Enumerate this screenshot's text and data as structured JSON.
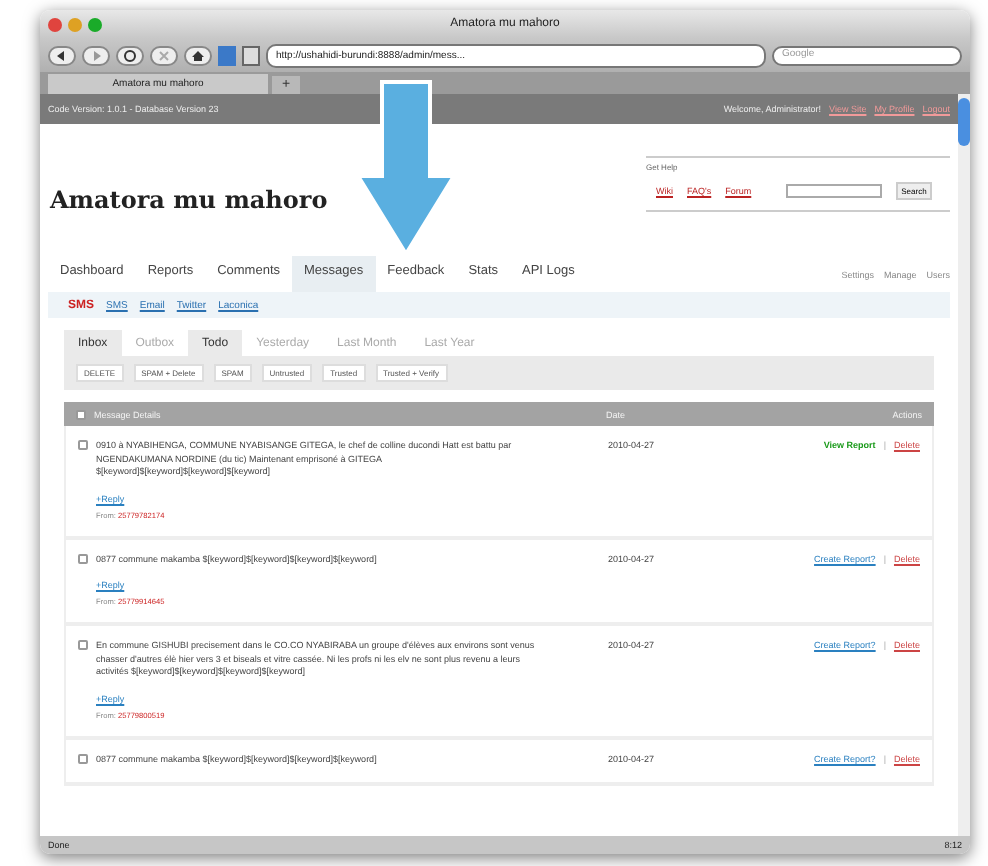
{
  "window": {
    "title": "Amatora mu mahoro"
  },
  "browser": {
    "address": "http://ushahidi-burundi:8888/admin/mess...",
    "search_placeholder": "Google",
    "tab": "Amatora mu mahoro",
    "new_tab": "+",
    "status": "Done",
    "clock": "8:12"
  },
  "header": {
    "version": "Code Version: 1.0.1 - Database Version 23",
    "welcome": "Welcome, Administrator!",
    "links": [
      "View Site",
      "My Profile",
      "Logout"
    ]
  },
  "site_title": "Amatora mu mahoro",
  "help": {
    "label": "Get Help",
    "links": [
      "Wiki",
      "FAQ's",
      "Forum"
    ],
    "search_button": "Search"
  },
  "nav": {
    "tabs": [
      {
        "label": "Dashboard",
        "selected": false
      },
      {
        "label": "Reports",
        "selected": false
      },
      {
        "label": "Comments",
        "selected": false
      },
      {
        "label": "Messages",
        "selected": true
      },
      {
        "label": "Feedback",
        "selected": false
      },
      {
        "label": "Stats",
        "selected": false
      },
      {
        "label": "API Logs",
        "selected": false
      }
    ],
    "right_links": [
      "Settings",
      "Manage",
      "Users"
    ]
  },
  "sub_nav": {
    "current": "SMS",
    "links": [
      "SMS",
      "Email",
      "Twitter",
      "Laconica"
    ]
  },
  "message_tabs": [
    {
      "label": "Inbox",
      "selected": true
    },
    {
      "label": "Outbox",
      "selected": false
    },
    {
      "label": "Todo",
      "selected": true
    },
    {
      "label": "Yesterday",
      "selected": false
    },
    {
      "label": "Last Month",
      "selected": false
    },
    {
      "label": "Last Year",
      "selected": false
    }
  ],
  "actions": [
    "DELETE",
    "SPAM + Delete",
    "SPAM",
    "Untrusted",
    "Trusted",
    "Trusted + Verify"
  ],
  "table": {
    "columns": [
      "Message Details",
      "Date",
      "Actions"
    ],
    "header_checked": false,
    "rows": [
      {
        "message": "0910 à NYABIHENGA, COMMUNE NYABISANGE GITEGA, le chef de colline ducondi Hatt est battu par NGENDAKUMANA NORDINE (du tic) Maintenant emprisoné à GITEGA $[keyword]$[keyword]$[keyword]$[keyword]",
        "reply": "+Reply",
        "from_label": "From:",
        "from": "25779782174",
        "date": "2010-04-27",
        "action": "View Report",
        "kind": "view",
        "separator": "|",
        "delete": "Delete",
        "checked": false
      },
      {
        "message": "0877 commune makamba $[keyword]$[keyword]$[keyword]$[keyword]",
        "reply": "+Reply",
        "from_label": "From:",
        "from": "25779914645",
        "date": "2010-04-27",
        "action": "Create Report?",
        "kind": "create",
        "separator": "|",
        "delete": "Delete",
        "checked": false
      },
      {
        "message": "En commune GISHUBI precisement dans le CO.CO NYABIRABA un groupe d'élèves aux environs sont venus chasser d'autres élè hier vers 3 et biseals et vitre cassée. Ni les profs ni les elv ne sont plus revenu a leurs activités $[keyword]$[keyword]$[keyword]$[keyword]",
        "reply": "+Reply",
        "from_label": "From:",
        "from": "25779800519",
        "date": "2010-04-27",
        "action": "Create Report?",
        "kind": "create",
        "separator": "|",
        "delete": "Delete",
        "checked": false
      },
      {
        "message": "0877 commune makamba $[keyword]$[keyword]$[keyword]$[keyword]",
        "date": "2010-04-27",
        "action": "Create Report?",
        "kind": "create",
        "separator": "|",
        "delete": "Delete",
        "checked": false
      }
    ]
  }
}
